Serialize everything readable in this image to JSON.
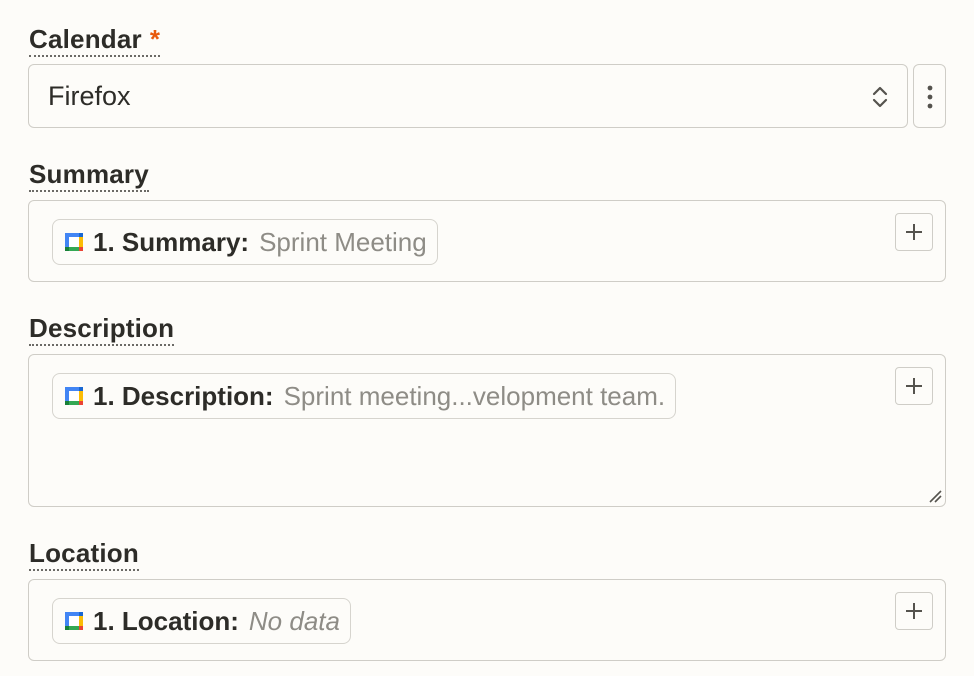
{
  "calendar": {
    "label": "Calendar",
    "required_mark": "*",
    "selected": "Firefox"
  },
  "summary": {
    "label": "Summary",
    "pill": {
      "key": "1. Summary:",
      "value": "Sprint Meeting"
    }
  },
  "description": {
    "label": "Description",
    "pill": {
      "key": "1. Description:",
      "value": "Sprint meeting...velopment team."
    }
  },
  "location": {
    "label": "Location",
    "pill": {
      "key": "1. Location:",
      "value": "No data"
    }
  },
  "colors": {
    "required": "#e8590c",
    "border": "#cfcdc7",
    "muted_text": "#8e8c86",
    "background": "#fdfcf9"
  },
  "icons": {
    "app": "google-calendar-icon",
    "select": "chevron-up-down-icon",
    "menu": "kebab-menu-icon",
    "add": "plus-icon",
    "resize": "resize-handle-icon"
  }
}
